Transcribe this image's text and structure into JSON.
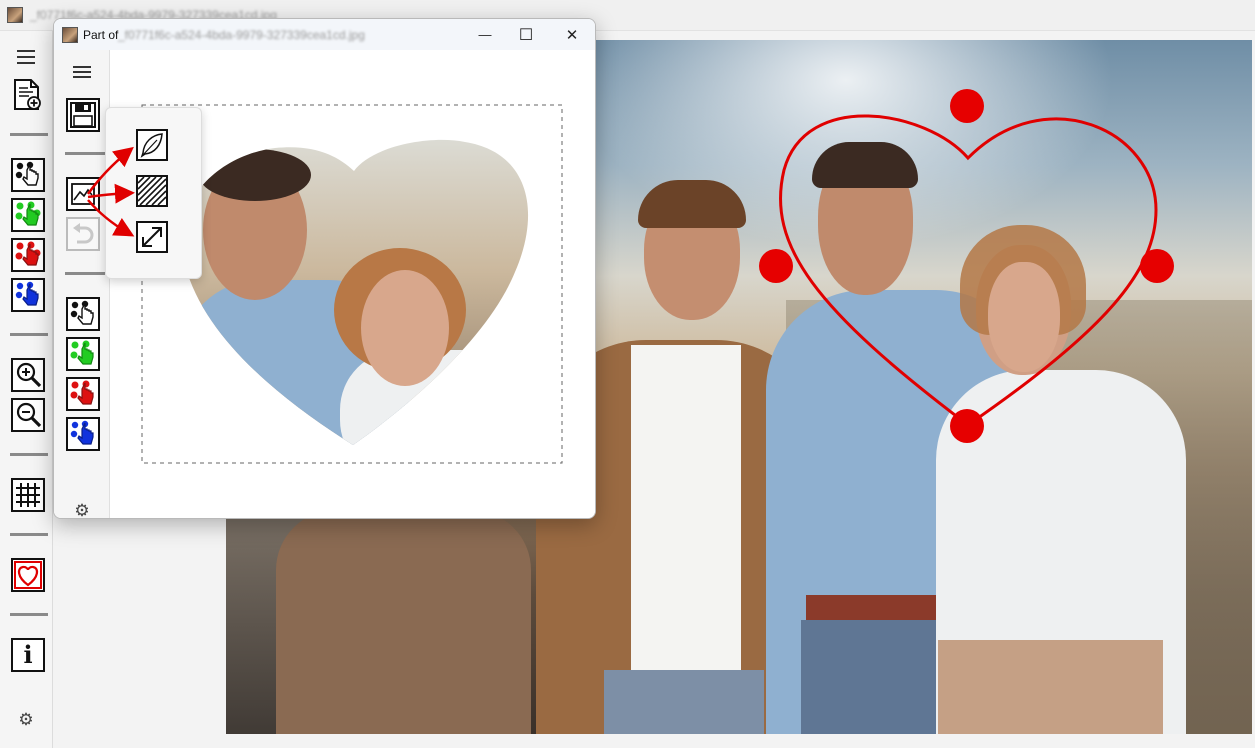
{
  "main_window": {
    "title": "_f0771f6c-a524-4bda-9979-327339cea1cd.jpg"
  },
  "sub_window": {
    "title_prefix": "Part of",
    "title_file": "_f0771f6c-a524-4bda-9979-327339cea1cd.jpg",
    "minimize_glyph": "—",
    "maximize_glyph": "☐",
    "close_glyph": "✕"
  },
  "icons": {
    "menu": "hamburger-menu-icon",
    "new_document": "new-document-icon",
    "save": "floppy-save-icon",
    "zoom_in": "zoom-in-icon",
    "zoom_out": "zoom-out-icon",
    "grid": "grid-icon",
    "heart_crop": "heart-crop-icon",
    "info": "info-icon",
    "settings": "gear-icon",
    "feather": "feather-icon",
    "hatch": "hatch-fill-icon",
    "resize": "resize-arrows-icon"
  },
  "colors": {
    "heart_stroke": "#e00000",
    "handle_fill": "#e60000",
    "dot_black": "#111111",
    "dot_green": "#22cc22",
    "dot_red": "#dd1111",
    "dot_blue": "#1133dd",
    "arrow_red": "#e00000"
  },
  "info_glyph": "i"
}
